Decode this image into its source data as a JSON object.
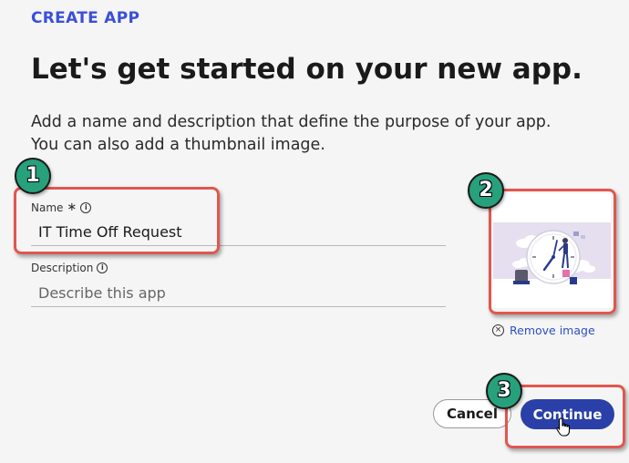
{
  "header": {
    "eyebrow": "CREATE APP",
    "title": "Let's get started on your new app.",
    "subtitle_line1": "Add a name and description that define the purpose of your app.",
    "subtitle_line2": "You can also add a thumbnail image."
  },
  "form": {
    "name": {
      "label": "Name",
      "required_icon": "asterisk-icon",
      "info_icon": "info-icon",
      "value": "IT Time Off Request"
    },
    "description": {
      "label": "Description",
      "info_icon": "info-icon",
      "placeholder": "Describe this app",
      "value": ""
    }
  },
  "thumbnail": {
    "remove_label": "Remove image",
    "remove_icon": "close-circle-icon"
  },
  "actions": {
    "cancel_label": "Cancel",
    "continue_label": "Continue"
  },
  "callouts": [
    "1",
    "2",
    "3"
  ],
  "colors": {
    "accent": "#3a4fd8",
    "primary_button": "#2a40a8",
    "callout_border": "#e0574f",
    "badge_fill": "#26a17b",
    "link": "#2e4fc4"
  }
}
